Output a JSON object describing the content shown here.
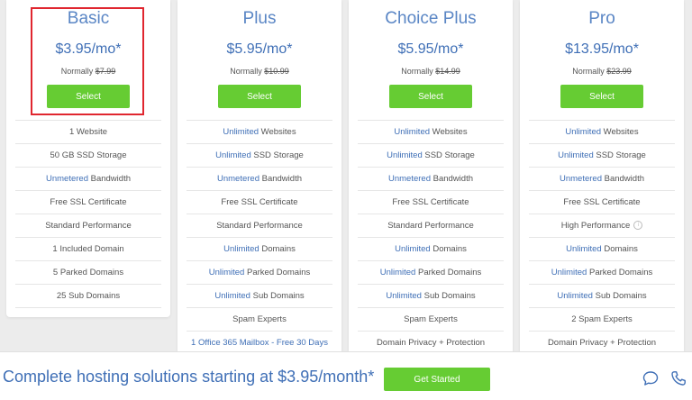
{
  "plans": [
    {
      "name": "Basic",
      "price": "$3.95/mo*",
      "normally_label": "Normally ",
      "normally_price": "$7.99",
      "select_label": "Select",
      "features": [
        {
          "pre": "",
          "hl": "",
          "post": "1 Website"
        },
        {
          "pre": "",
          "hl": "",
          "post": "50 GB SSD Storage"
        },
        {
          "pre": "",
          "hl": "Unmetered",
          "post": " Bandwidth"
        },
        {
          "pre": "",
          "hl": "",
          "post": "Free SSL Certificate"
        },
        {
          "pre": "",
          "hl": "",
          "post": "Standard Performance"
        },
        {
          "pre": "",
          "hl": "",
          "post": "1 Included Domain"
        },
        {
          "pre": "",
          "hl": "",
          "post": "5 Parked Domains"
        },
        {
          "pre": "",
          "hl": "",
          "post": "25 Sub Domains"
        }
      ]
    },
    {
      "name": "Plus",
      "price": "$5.95/mo*",
      "normally_label": "Normally ",
      "normally_price": "$10.99",
      "select_label": "Select",
      "features": [
        {
          "pre": "",
          "hl": "Unlimited",
          "post": " Websites"
        },
        {
          "pre": "",
          "hl": "Unlimited",
          "post": " SSD Storage"
        },
        {
          "pre": "",
          "hl": "Unmetered",
          "post": " Bandwidth"
        },
        {
          "pre": "",
          "hl": "",
          "post": "Free SSL Certificate"
        },
        {
          "pre": "",
          "hl": "",
          "post": "Standard Performance"
        },
        {
          "pre": "",
          "hl": "Unlimited",
          "post": " Domains"
        },
        {
          "pre": "",
          "hl": "Unlimited",
          "post": " Parked Domains"
        },
        {
          "pre": "",
          "hl": "Unlimited",
          "post": " Sub Domains"
        },
        {
          "pre": "",
          "hl": "",
          "post": "Spam Experts"
        },
        {
          "pre": "",
          "hl": "1 Office 365 Mailbox - Free 30 Days",
          "post": ""
        }
      ]
    },
    {
      "name": "Choice Plus",
      "price": "$5.95/mo*",
      "normally_label": "Normally ",
      "normally_price": "$14.99",
      "select_label": "Select",
      "features": [
        {
          "pre": "",
          "hl": "Unlimited",
          "post": " Websites"
        },
        {
          "pre": "",
          "hl": "Unlimited",
          "post": " SSD Storage"
        },
        {
          "pre": "",
          "hl": "Unmetered",
          "post": " Bandwidth"
        },
        {
          "pre": "",
          "hl": "",
          "post": "Free SSL Certificate"
        },
        {
          "pre": "",
          "hl": "",
          "post": "Standard Performance"
        },
        {
          "pre": "",
          "hl": "Unlimited",
          "post": " Domains"
        },
        {
          "pre": "",
          "hl": "Unlimited",
          "post": " Parked Domains"
        },
        {
          "pre": "",
          "hl": "Unlimited",
          "post": " Sub Domains"
        },
        {
          "pre": "",
          "hl": "",
          "post": "Spam Experts"
        },
        {
          "pre": "",
          "hl": "",
          "post": "Domain Privacy + Protection"
        }
      ]
    },
    {
      "name": "Pro",
      "price": "$13.95/mo*",
      "normally_label": "Normally ",
      "normally_price": "$23.99",
      "select_label": "Select",
      "features": [
        {
          "pre": "",
          "hl": "Unlimited",
          "post": " Websites"
        },
        {
          "pre": "",
          "hl": "Unlimited",
          "post": " SSD Storage"
        },
        {
          "pre": "",
          "hl": "Unmetered",
          "post": " Bandwidth"
        },
        {
          "pre": "",
          "hl": "",
          "post": "Free SSL Certificate"
        },
        {
          "pre": "",
          "hl": "",
          "post": "High Performance",
          "info": "i"
        },
        {
          "pre": "",
          "hl": "Unlimited",
          "post": " Domains"
        },
        {
          "pre": "",
          "hl": "Unlimited",
          "post": " Parked Domains"
        },
        {
          "pre": "",
          "hl": "Unlimited",
          "post": " Sub Domains"
        },
        {
          "pre": "",
          "hl": "",
          "post": "2 Spam Experts"
        },
        {
          "pre": "",
          "hl": "",
          "post": "Domain Privacy + Protection"
        }
      ]
    }
  ],
  "bottom_bar": {
    "cta_text": "Complete hosting solutions starting at $3.95/month*",
    "get_started_label": "Get Started"
  },
  "colors": {
    "accent_blue": "#3f6fb6",
    "button_green": "#66cc33",
    "highlight_red": "#e0262f"
  },
  "icons": {
    "chat": "chat-bubble-icon",
    "phone": "phone-icon"
  }
}
